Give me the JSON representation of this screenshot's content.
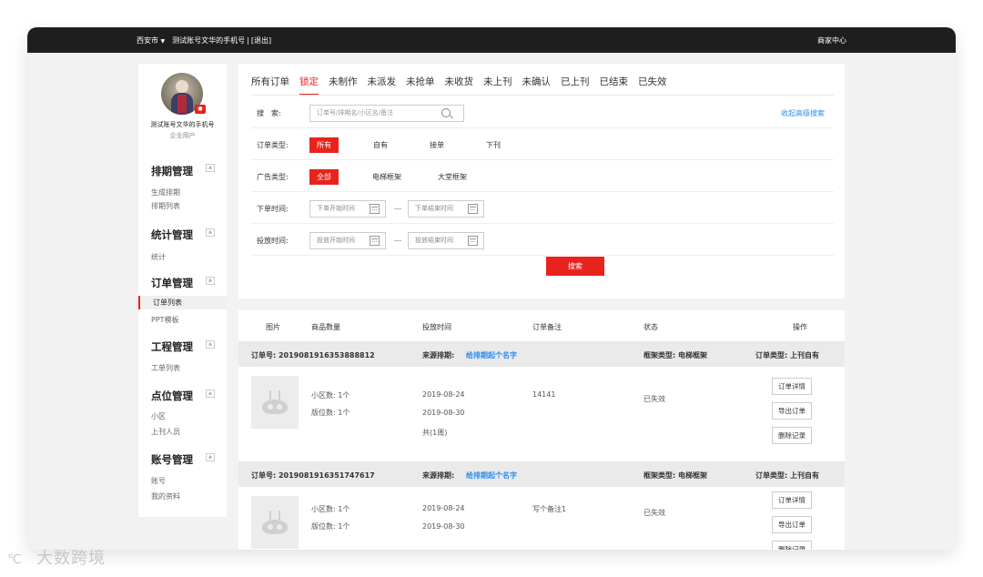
{
  "topbar": {
    "city": "西安市",
    "phone_label": "测试账号文华的手机号",
    "separator": "|",
    "logout": "[退出]",
    "merchant_center": "商家中心"
  },
  "profile": {
    "name": "测试账号文华的手机号",
    "type": "企业用户"
  },
  "sidebar": {
    "groups": [
      {
        "title": "排期管理",
        "items": [
          "生成排期",
          "排期列表"
        ]
      },
      {
        "title": "统计管理",
        "items": [
          "统计"
        ]
      },
      {
        "title": "订单管理",
        "items": [
          "订单列表",
          "PPT模板"
        ]
      },
      {
        "title": "工程管理",
        "items": [
          "工单列表"
        ]
      },
      {
        "title": "点位管理",
        "items": [
          "小区",
          "上刊人员"
        ]
      },
      {
        "title": "账号管理",
        "items": [
          "账号",
          "我的资料"
        ]
      }
    ],
    "active_item": "订单列表",
    "toggle_symbol": "▲"
  },
  "tabs": [
    "所有订单",
    "锁定",
    "未制作",
    "未派发",
    "未抢单",
    "未收货",
    "未上刊",
    "未确认",
    "已上刊",
    "已结束",
    "已失效"
  ],
  "active_tab": "锁定",
  "filters": {
    "search_label": "搜　索:",
    "search_placeholder": "订单号/排期名/小区名/备注",
    "advanced_link": "收起高级搜索",
    "order_type_label": "订单类型:",
    "order_type_options": [
      "所有",
      "自有",
      "接单",
      "下刊"
    ],
    "ad_type_label": "广告类型:",
    "ad_type_options": [
      "全部",
      "电梯框架",
      "大堂框架"
    ],
    "order_time_label": "下单时间:",
    "order_time_start": "下单开始时间",
    "order_time_end": "下单结束时间",
    "release_time_label": "投放时间:",
    "release_time_start": "投放开始时间",
    "release_time_end": "投放结束时间",
    "search_button": "搜索"
  },
  "table": {
    "headers": [
      "图片",
      "商品数量",
      "投放时间",
      "订单备注",
      "状态",
      "操作"
    ],
    "orders": [
      {
        "order_no": "订单号: 2019081916353888812",
        "source_label": "来源排期:",
        "source_link": "给排期起个名字",
        "frame_type": "框架类型: 电梯框架",
        "order_type": "订单类型: 上刊自有",
        "community": "小区数: 1个",
        "slots": "版位数: 1个",
        "start": "2019-08-24",
        "end": "2019-08-30",
        "duration": "共(1周)",
        "remark": "14141",
        "status": "已失效",
        "actions": [
          "订单详情",
          "导出订单",
          "删除记录"
        ]
      },
      {
        "order_no": "订单号: 2019081916351747617",
        "source_label": "来源排期:",
        "source_link": "给排期起个名字",
        "frame_type": "框架类型: 电梯框架",
        "order_type": "订单类型: 上刊自有",
        "community": "小区数: 1个",
        "slots": "版位数: 1个",
        "start": "2019-08-24",
        "end": "2019-08-30",
        "duration": "",
        "remark": "写个备注1",
        "status": "已失效",
        "actions": [
          "订单详情",
          "导出订单",
          "删除记录"
        ]
      }
    ]
  },
  "watermark": {
    "logo": "℃",
    "text": "大数跨境"
  },
  "colors": {
    "accent": "#e8231d",
    "link": "#2d8cf0",
    "topbar": "#1e1e1e"
  }
}
